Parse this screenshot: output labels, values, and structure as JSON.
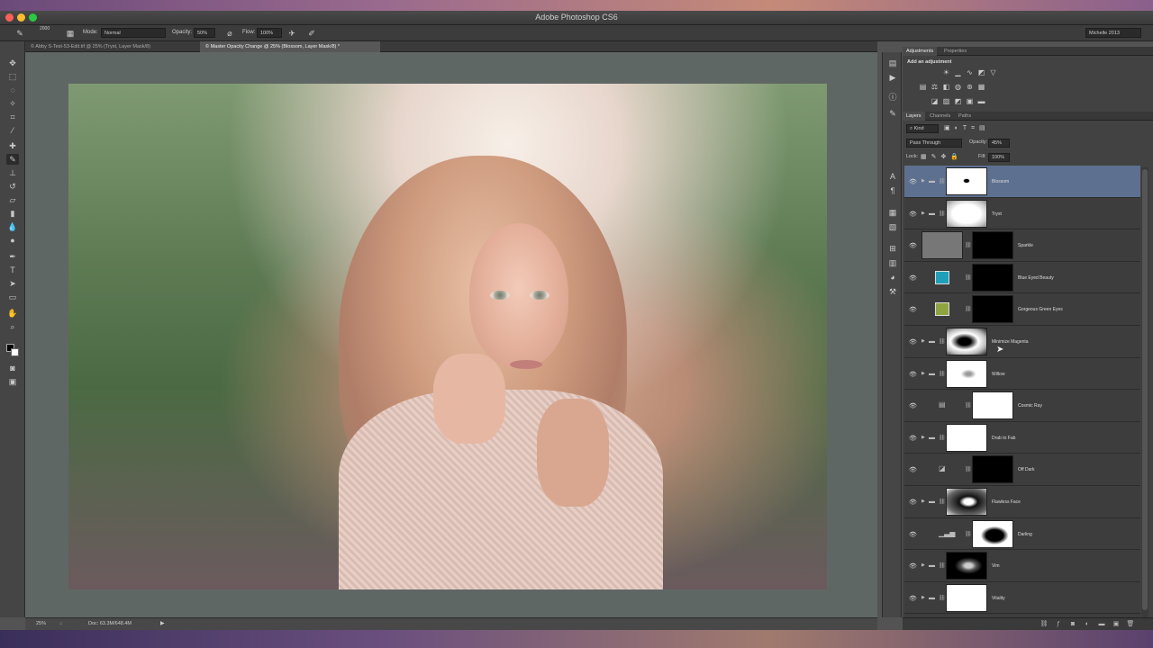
{
  "window": {
    "title": "Adobe Photoshop CS6",
    "user": "Michelle 2013"
  },
  "options": {
    "brush_size": "2000",
    "mode_label": "Mode:",
    "mode_value": "Normal",
    "opacity_label": "Opacity:",
    "opacity_value": "50%",
    "flow_label": "Flow:",
    "flow_value": "100%"
  },
  "tabs": [
    {
      "label": "© Abby S-Test-53-Edit.tif @ 25% (Tryst, Layer Mask/8)"
    },
    {
      "label": "© Master Opacity Change @ 25% (Blossom, Layer Mask/8) *"
    }
  ],
  "status": {
    "zoom": "25%",
    "doc": "Doc: 63.3M/648.4M"
  },
  "panels": {
    "adjustments_tab": "Adjustments",
    "properties_tab": "Properties",
    "add_adjustment": "Add an adjustment",
    "layers_tab": "Layers",
    "channels_tab": "Channels",
    "paths_tab": "Paths",
    "kind": "Kind",
    "blend_mode": "Pass Through",
    "opacity_label": "Opacity:",
    "opacity_value": "45%",
    "lock_label": "Lock:",
    "fill_label": "Fill:",
    "fill_value": "100%"
  },
  "layers": [
    {
      "name": "Blossom"
    },
    {
      "name": "Tryst"
    },
    {
      "name": "Sparkle"
    },
    {
      "name": "Blue Eyed Beauty"
    },
    {
      "name": "Gorgeous Green Eyes"
    },
    {
      "name": "Minimize Magenta"
    },
    {
      "name": "Willow"
    },
    {
      "name": "Cosmic Ray"
    },
    {
      "name": "Drab to Fab"
    },
    {
      "name": "Off Dark"
    },
    {
      "name": "Flawless Face"
    },
    {
      "name": "Darling"
    },
    {
      "name": "Vim"
    },
    {
      "name": "Vitality"
    }
  ],
  "colors": {
    "selection": "#5d7090",
    "blue_eyed_swatch": "#1fa0b8",
    "green_eyes_swatch": "#8fa441"
  }
}
